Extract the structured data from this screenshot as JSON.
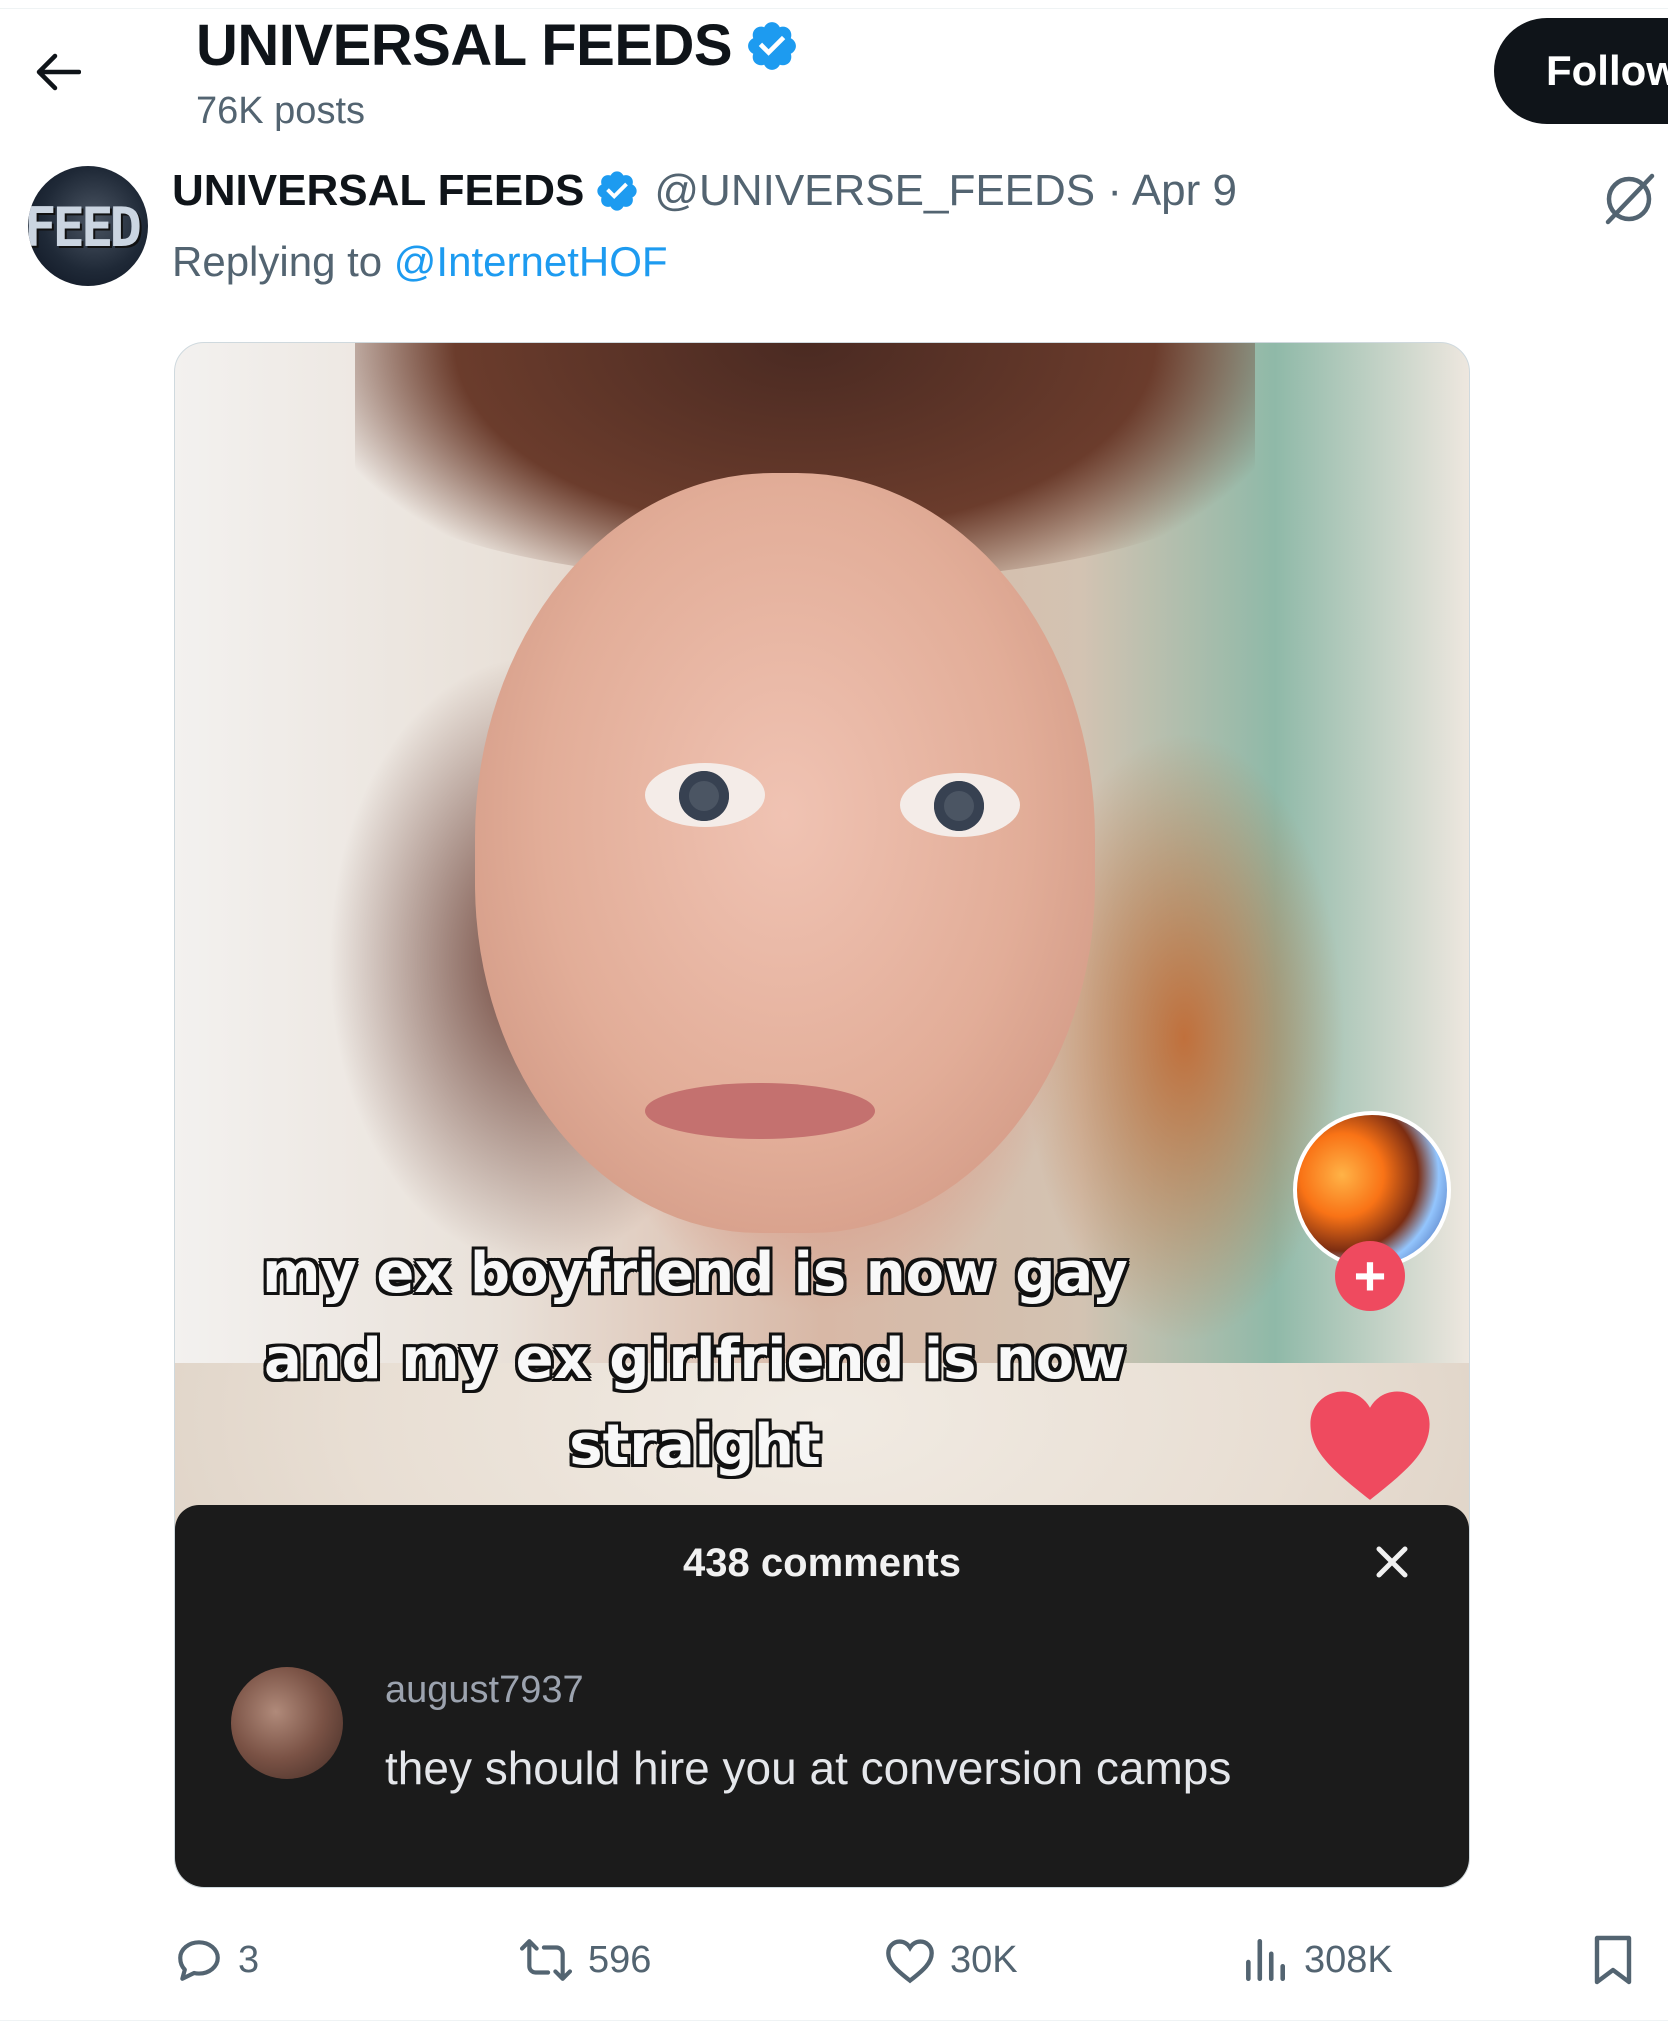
{
  "header": {
    "title": "UNIVERSAL FEEDS",
    "posts_count": "76K posts",
    "follow_label": "Follow"
  },
  "tweet": {
    "avatar_text": "FEED",
    "author_name": "UNIVERSAL FEEDS",
    "meta": "@UNIVERSE_FEEDS · Apr 9",
    "replying_prefix": "Replying to",
    "replying_handle": "@InternetHOF",
    "media": {
      "caption_lines": [
        "my ex boyfriend is now gay",
        "and my ex girlfriend is now",
        "straight"
      ],
      "comments_count": "438 comments",
      "comment": {
        "username": "august7937",
        "text": "they should hire you at conversion camps"
      }
    },
    "actions": {
      "replies": "3",
      "reposts": "596",
      "likes": "30K",
      "views": "308K"
    }
  },
  "colors": {
    "accent_blue": "#1d9bf0",
    "text_secondary": "#536471",
    "follow_bg": "#0f1419",
    "tiktok_red": "#ef4a5f"
  },
  "icons": [
    "back-arrow-icon",
    "verified-badge-icon",
    "grok-icon",
    "plus-icon",
    "heart-icon",
    "close-icon",
    "reply-icon",
    "repost-icon",
    "like-icon",
    "views-icon",
    "bookmark-icon"
  ]
}
